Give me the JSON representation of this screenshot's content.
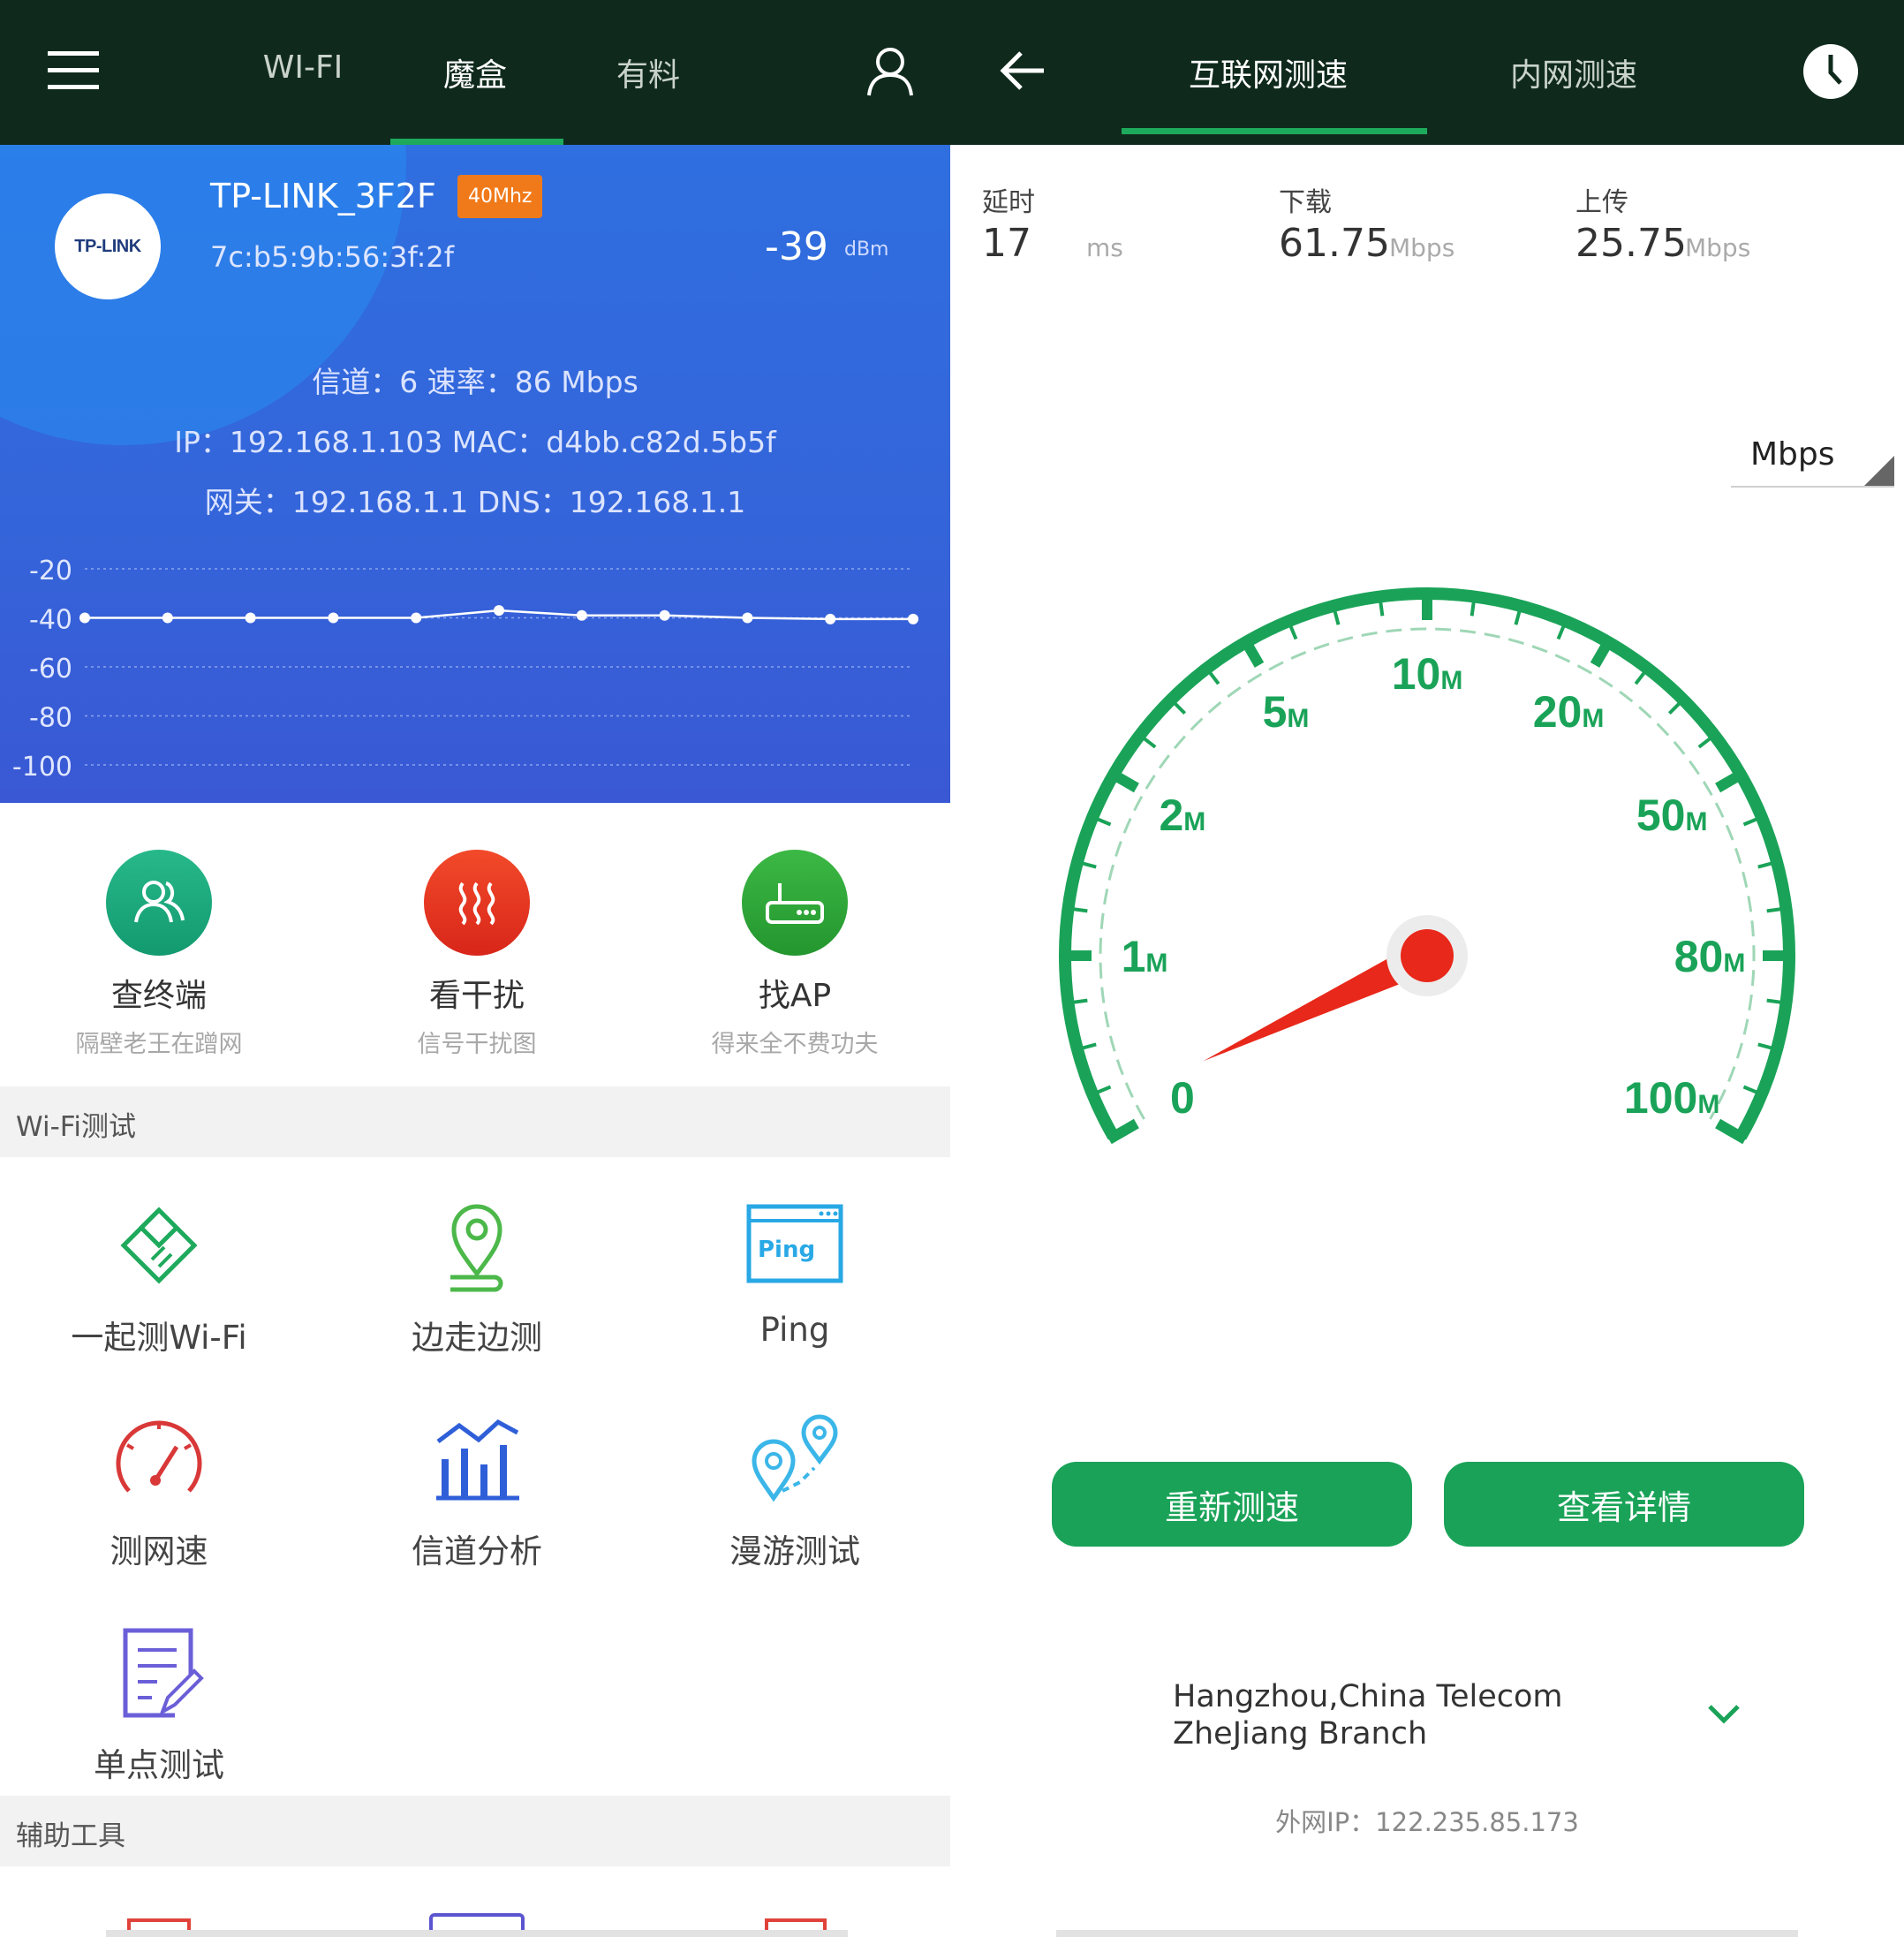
{
  "left": {
    "tabs": [
      {
        "label": "WI-FI",
        "active": false
      },
      {
        "label": "魔盒",
        "active": true
      },
      {
        "label": "有料",
        "active": false
      }
    ],
    "icons": {
      "menu": "menu-icon",
      "user": "user-icon"
    },
    "wifi": {
      "logo_text": "TP-LINK",
      "ssid": "TP-LINK_3F2F",
      "bandwidth": "40Mhz",
      "bssid": "7c:b5:9b:56:3f:2f",
      "rssi": "-39",
      "rssi_unit": "dBm",
      "line1": "信道：6   速率：86 Mbps",
      "line2": "IP：192.168.1.103   MAC：d4bb.c82d.5b5f",
      "line3": "网关：192.168.1.1   DNS：192.168.1.1"
    },
    "chart_data": {
      "type": "line",
      "y_ticks": [
        "-20",
        "-40",
        "-60",
        "-80",
        "-100"
      ],
      "ylim": [
        -100,
        -20
      ],
      "series": [
        {
          "values": [
            -40,
            -40,
            -40,
            -40,
            -40,
            -37,
            -39,
            -39,
            -40,
            -40.5,
            -40.5
          ]
        }
      ],
      "grid": true,
      "colors": {
        "line": "#ffffff",
        "grid": "#8aa4ee"
      }
    },
    "features": [
      {
        "title": "查终端",
        "subtitle": "隔壁老王在蹭网",
        "color": "#1aa37b",
        "icon": "users-icon"
      },
      {
        "title": "看干扰",
        "subtitle": "信号干扰图",
        "color": "#e8351f",
        "icon": "interference-icon"
      },
      {
        "title": "找AP",
        "subtitle": "得来全不费功夫",
        "color": "#2ea63a",
        "icon": "router-icon"
      }
    ],
    "section_wifi_test": "Wi-Fi测试",
    "tools": [
      {
        "label": "一起测Wi-Fi",
        "icon": "handshake-icon"
      },
      {
        "label": "边走边测",
        "icon": "location-walk-icon"
      },
      {
        "label": "Ping",
        "icon": "ping-icon",
        "icon_text": "Ping"
      },
      {
        "label": "测网速",
        "icon": "speedometer-icon"
      },
      {
        "label": "信道分析",
        "icon": "channel-chart-icon"
      },
      {
        "label": "漫游测试",
        "icon": "roaming-pins-icon"
      },
      {
        "label": "单点测试",
        "icon": "single-test-doc-icon"
      }
    ],
    "section_aux_tools": "辅助工具"
  },
  "right": {
    "tabs": [
      {
        "label": "互联网测速",
        "active": true
      },
      {
        "label": "内网测速",
        "active": false
      }
    ],
    "icons": {
      "back": "back-arrow-icon",
      "history": "clock-icon"
    },
    "metrics": [
      {
        "label": "延时",
        "value": "17",
        "unit": "ms"
      },
      {
        "label": "下载",
        "value": "61.75",
        "unit": "Mbps"
      },
      {
        "label": "上传",
        "value": "25.75",
        "unit": "Mbps"
      }
    ],
    "unit_selector": "Mbps",
    "gauge": {
      "labels": [
        {
          "num": "0",
          "suffix": ""
        },
        {
          "num": "1",
          "suffix": "M"
        },
        {
          "num": "2",
          "suffix": "M"
        },
        {
          "num": "5",
          "suffix": "M"
        },
        {
          "num": "10",
          "suffix": "M"
        },
        {
          "num": "20",
          "suffix": "M"
        },
        {
          "num": "50",
          "suffix": "M"
        },
        {
          "num": "80",
          "suffix": "M"
        },
        {
          "num": "100",
          "suffix": "M"
        }
      ],
      "needle_value": "0",
      "colors": {
        "ring": "#1aa358",
        "needle": "#e8281a"
      }
    },
    "buttons": {
      "retest": "重新测速",
      "details": "查看详情"
    },
    "server": "Hangzhou,China Telecom ZheJiang Branch",
    "external_ip": "外网IP：122.235.85.173"
  }
}
